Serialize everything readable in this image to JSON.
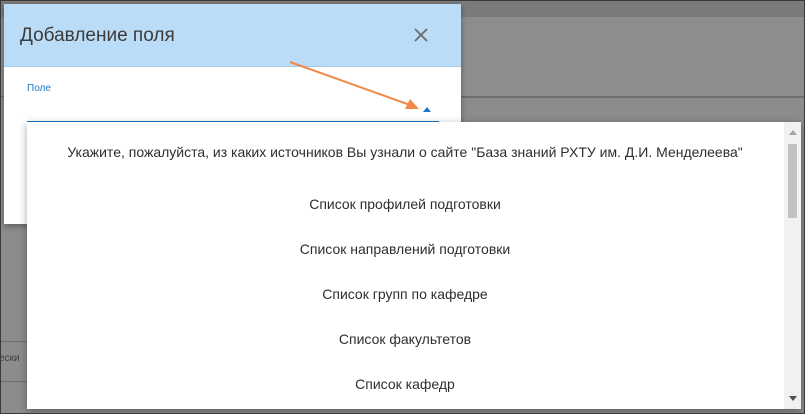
{
  "dialog": {
    "title": "Добавление поля",
    "field_label": "Поле",
    "field_value": ""
  },
  "dropdown": {
    "options": [
      "Укажите, пожалуйста, из каких источников Вы узнали о сайте \"База знаний РХТУ им. Д.И. Менделеева\"",
      "Список профилей подготовки",
      "Список направлений подготовки",
      "Список групп по кафедре",
      "Список факультетов",
      "Список кафедр"
    ]
  },
  "background": {
    "fragment_text": "ески"
  },
  "colors": {
    "header_bg": "#bbdcf6",
    "accent": "#1e78c8",
    "annotation_arrow": "#f08a4b",
    "overlay": "#8a8a8a"
  },
  "icons": {
    "close": "close-icon",
    "dropdown_caret": "caret-up-icon"
  }
}
